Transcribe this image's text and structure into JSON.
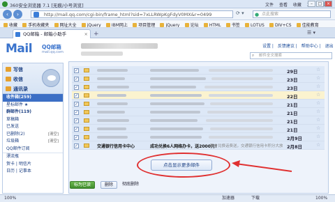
{
  "browser": {
    "title": "360安全浏览器 7.1 [无痕/小号浏览]",
    "menus": [
      "文件",
      "查看",
      "收藏",
      "工具",
      "帮助"
    ],
    "url": "http://mail.qq.com/cgi-bin/frame_html?sid=7xLLRWpKgFdyV0MX&r=0499",
    "search_placeholder": "点此搜索",
    "favorites": [
      "收藏",
      "手机收藏夹",
      "网址大全",
      "jQuery",
      "IBM网上",
      "项目管理",
      "jQuery",
      "论坛",
      "HTML",
      "书签",
      "LOTUS",
      "DIV+CS",
      "佳能教育"
    ],
    "tab_label": "QQ邮箱 - 邮箱小助手",
    "status_items": [
      "100%",
      "加速器",
      "下载",
      "100%"
    ]
  },
  "mail": {
    "logo_text": "Mail",
    "logo_brand": "QQ邮箱",
    "logo_domain": "mail.qq.com",
    "top_links": [
      "设置",
      "反馈建议",
      "帮助中心",
      "退出"
    ],
    "search_placeholder": "邮件全文搜索",
    "actions": {
      "write": "写信",
      "receive": "收信",
      "contacts": "通讯录"
    },
    "folders": [
      {
        "label": "收件箱(259)",
        "selected": true,
        "extra": ""
      },
      {
        "label": "星标邮件 ★",
        "selected": false,
        "extra": ""
      },
      {
        "label": "群邮件(119)",
        "selected": false,
        "extra": "",
        "bold": true
      },
      {
        "label": "草稿箱",
        "selected": false,
        "extra": ""
      },
      {
        "label": "已发送",
        "selected": false,
        "extra": ""
      },
      {
        "label": "已删除(2)",
        "selected": false,
        "extra": "[清空]"
      },
      {
        "label": "垃圾箱",
        "selected": false,
        "extra": "[清空]"
      },
      {
        "label": "QQ邮件订阅",
        "selected": false,
        "extra": ""
      },
      {
        "label": "漂流瓶",
        "selected": false,
        "extra": ""
      },
      {
        "label": "贺卡 | 明信片",
        "selected": false,
        "extra": ""
      },
      {
        "label": "日历 | 记事本",
        "selected": false,
        "extra": ""
      }
    ],
    "rows": [
      {
        "date": "29日",
        "kind": "unread"
      },
      {
        "date": "23日",
        "kind": "unread"
      },
      {
        "date": "23日",
        "kind": "unread"
      },
      {
        "date": "22日",
        "kind": "hl"
      },
      {
        "date": "21日",
        "kind": "unread"
      },
      {
        "date": "21日",
        "kind": "unread"
      },
      {
        "date": "21日",
        "kind": "unread"
      },
      {
        "date": "21日",
        "kind": "unread"
      },
      {
        "date": "2月9日",
        "kind": "unread"
      }
    ],
    "last_row": {
      "sender": "交通银行信用卡中心",
      "subject": "成功兑换6人网络办卡，送2000元！",
      "snippet": "积分兑换话费送，交通银行信用卡积分大放送",
      "date": "2月8日"
    },
    "more_button": "点击显示更多邮件",
    "bottom_buttons": [
      "标为已读",
      "删除",
      "彻底删除"
    ]
  }
}
